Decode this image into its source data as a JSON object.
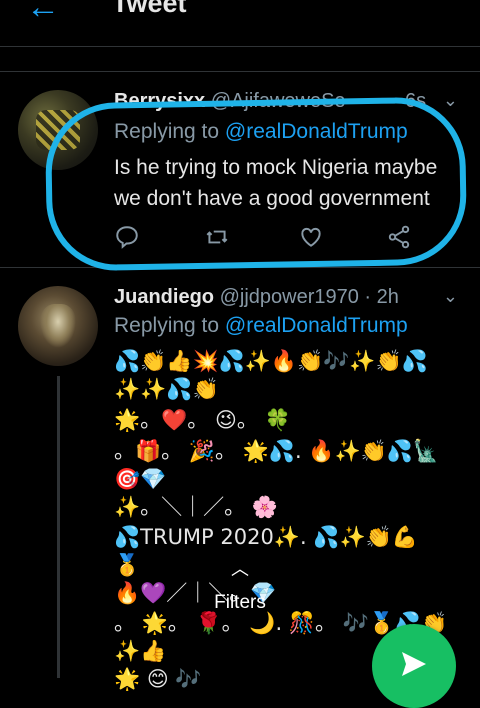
{
  "header": {
    "back_icon": "arrow-left-icon",
    "title": "Tweet"
  },
  "tweets": [
    {
      "display_name": "Berrysixx",
      "handle": "@AjifaweweSe",
      "time": "6s",
      "replying_prefix": "Replying to",
      "replying_to": "@realDonaldTrump",
      "text_lines": [
        "Is he trying to mock Nigeria maybe",
        "we don't have a good government"
      ],
      "actions": [
        "reply-icon",
        "retweet-icon",
        "like-icon",
        "share-icon"
      ],
      "highlight_color": "#1fb3e8"
    },
    {
      "display_name": "Juandiego",
      "handle": "@jjdpower1970",
      "time": "· 2h",
      "replying_prefix": "Replying to",
      "replying_to": "@realDonaldTrump",
      "text_lines": [
        "💦👏👍💥💦✨🔥👏🎶✨👏💦",
        "✨✨💦👏",
        "🌟。❤️。 😉。 🍀",
        "。🎁。 🎉。 🌟💦.     🔥✨👏💦🗽",
        "🎯💎",
        "✨。＼｜／。 🌸",
        "💦TRUMP 2020✨.     💦✨👏💪",
        "🥇",
        "🔥💜／｜＼。💎",
        "。 🌟。 🌹。 🌙.   🎊。 🎶🥇💦👏",
        "✨👍",
        "🌟      😊     🎶"
      ]
    }
  ],
  "filters_label": "Filters",
  "colors": {
    "accent": "#1da1f2",
    "fab": "#17bf63",
    "background": "#000000"
  }
}
